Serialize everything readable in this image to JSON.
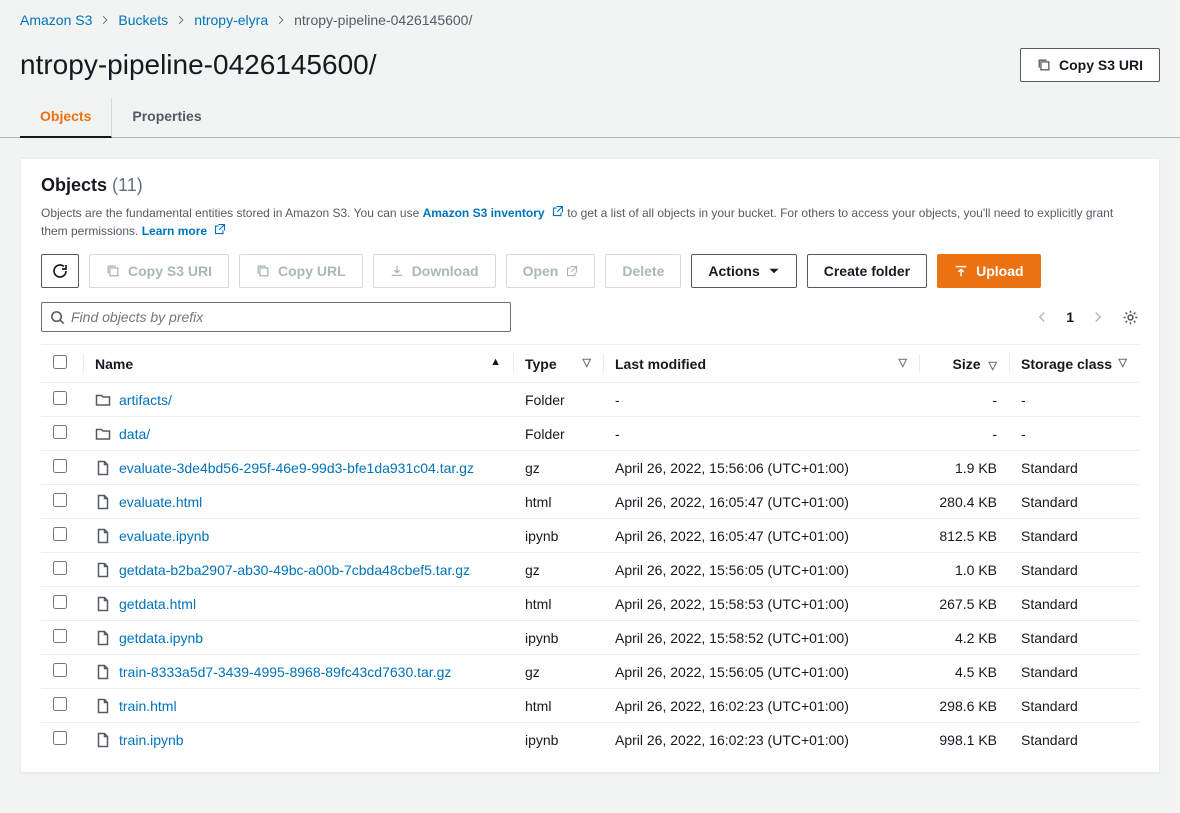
{
  "breadcrumb": {
    "items": [
      "Amazon S3",
      "Buckets",
      "ntropy-elyra"
    ],
    "current": "ntropy-pipeline-0426145600/"
  },
  "header": {
    "title": "ntropy-pipeline-0426145600/",
    "copy_uri": "Copy S3 URI"
  },
  "tabs": {
    "objects": "Objects",
    "properties": "Properties"
  },
  "section": {
    "title": "Objects",
    "count": "(11)",
    "desc_pre": "Objects are the fundamental entities stored in Amazon S3. You can use ",
    "inventory": "Amazon S3 inventory",
    "desc_mid": " to get a list of all objects in your bucket. For others to access your objects, you'll need to explicitly grant them permissions. ",
    "learn_more": "Learn more"
  },
  "toolbar": {
    "copy_uri": "Copy S3 URI",
    "copy_url": "Copy URL",
    "download": "Download",
    "open": "Open",
    "delete": "Delete",
    "actions": "Actions",
    "create_folder": "Create folder",
    "upload": "Upload"
  },
  "search": {
    "placeholder": "Find objects by prefix"
  },
  "pager": {
    "page": "1"
  },
  "columns": {
    "name": "Name",
    "type": "Type",
    "modified": "Last modified",
    "size": "Size",
    "storage": "Storage class"
  },
  "rows": [
    {
      "folder": true,
      "name": "artifacts/",
      "type": "Folder",
      "modified": "-",
      "size": "-",
      "storage": "-"
    },
    {
      "folder": true,
      "name": "data/",
      "type": "Folder",
      "modified": "-",
      "size": "-",
      "storage": "-"
    },
    {
      "folder": false,
      "name": "evaluate-3de4bd56-295f-46e9-99d3-bfe1da931c04.tar.gz",
      "type": "gz",
      "modified": "April 26, 2022, 15:56:06 (UTC+01:00)",
      "size": "1.9 KB",
      "storage": "Standard"
    },
    {
      "folder": false,
      "name": "evaluate.html",
      "type": "html",
      "modified": "April 26, 2022, 16:05:47 (UTC+01:00)",
      "size": "280.4 KB",
      "storage": "Standard"
    },
    {
      "folder": false,
      "name": "evaluate.ipynb",
      "type": "ipynb",
      "modified": "April 26, 2022, 16:05:47 (UTC+01:00)",
      "size": "812.5 KB",
      "storage": "Standard"
    },
    {
      "folder": false,
      "name": "getdata-b2ba2907-ab30-49bc-a00b-7cbda48cbef5.tar.gz",
      "type": "gz",
      "modified": "April 26, 2022, 15:56:05 (UTC+01:00)",
      "size": "1.0 KB",
      "storage": "Standard"
    },
    {
      "folder": false,
      "name": "getdata.html",
      "type": "html",
      "modified": "April 26, 2022, 15:58:53 (UTC+01:00)",
      "size": "267.5 KB",
      "storage": "Standard"
    },
    {
      "folder": false,
      "name": "getdata.ipynb",
      "type": "ipynb",
      "modified": "April 26, 2022, 15:58:52 (UTC+01:00)",
      "size": "4.2 KB",
      "storage": "Standard"
    },
    {
      "folder": false,
      "name": "train-8333a5d7-3439-4995-8968-89fc43cd7630.tar.gz",
      "type": "gz",
      "modified": "April 26, 2022, 15:56:05 (UTC+01:00)",
      "size": "4.5 KB",
      "storage": "Standard"
    },
    {
      "folder": false,
      "name": "train.html",
      "type": "html",
      "modified": "April 26, 2022, 16:02:23 (UTC+01:00)",
      "size": "298.6 KB",
      "storage": "Standard"
    },
    {
      "folder": false,
      "name": "train.ipynb",
      "type": "ipynb",
      "modified": "April 26, 2022, 16:02:23 (UTC+01:00)",
      "size": "998.1 KB",
      "storage": "Standard"
    }
  ]
}
